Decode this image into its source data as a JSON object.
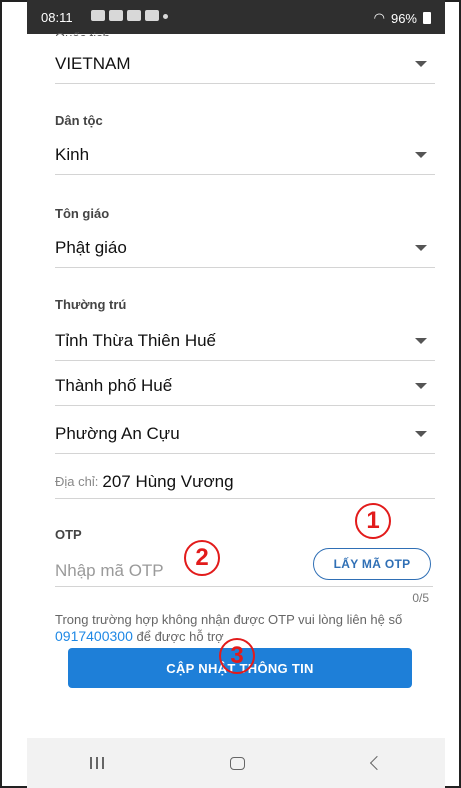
{
  "status_bar": {
    "time": "08:11",
    "signal_text": "96%"
  },
  "partial_label": "Quốc tịch",
  "fields": {
    "nationality": {
      "value": "VIETNAM"
    },
    "ethnicity": {
      "label": "Dân tộc",
      "value": "Kinh"
    },
    "religion": {
      "label": "Tôn giáo",
      "value": "Phật giáo"
    },
    "residence": {
      "label": "Thường trú",
      "province": "Tỉnh Thừa Thiên Huế",
      "city": "Thành phố Huế",
      "ward": "Phường An Cựu",
      "address_prefix": "Địa chỉ:",
      "address_value": "207 Hùng Vương"
    }
  },
  "otp": {
    "label": "OTP",
    "placeholder": "Nhập mã OTP",
    "button": "LẤY MÃ OTP",
    "counter": "0/5"
  },
  "help": {
    "text_before": "Trong trường hợp không nhận được OTP vui lòng liên hệ số",
    "phone": "0917400300",
    "text_after": "để được hỗ trợ"
  },
  "submit_button": "CẬP NHẬT THÔNG TIN",
  "annotations": {
    "one": "1",
    "two": "2",
    "three": "3",
    "color": "#e21b1b"
  }
}
